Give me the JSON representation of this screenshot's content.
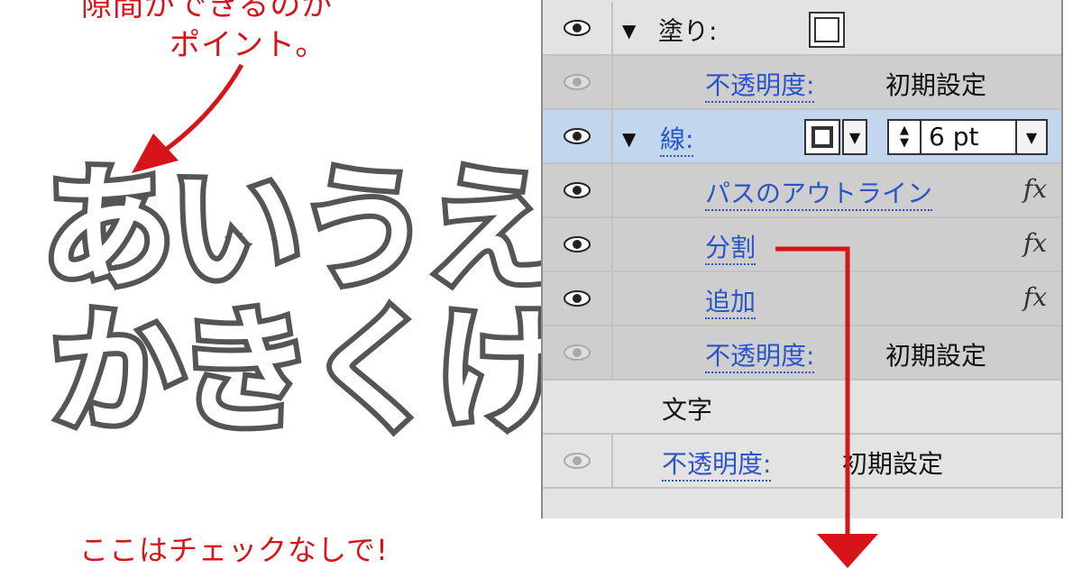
{
  "annotations": {
    "top_line1": "隙間ができるのが",
    "top_line2": "ポイント。",
    "bottom": "ここはチェックなしで!"
  },
  "sample_text": {
    "line1": "あいうえお",
    "line2": "かきくけこ"
  },
  "panel": {
    "fill": {
      "label": "塗り:"
    },
    "opacity_label": "不透明度:",
    "opacity_value": "初期設定",
    "stroke": {
      "label": "線:",
      "weight": "6 pt"
    },
    "effects": [
      {
        "label": "パスのアウトライン",
        "fx": "fx"
      },
      {
        "label": "分割",
        "fx": "fx"
      },
      {
        "label": "追加",
        "fx": "fx"
      }
    ],
    "character_label": "文字"
  },
  "colors": {
    "annotation_red": "#d7141a",
    "link_blue": "#2a55c8",
    "selected_row": "#c2d6ee"
  },
  "icons": [
    "eye-icon",
    "triangle-down-icon",
    "fx-icon",
    "chevron-down-icon",
    "stepper-icon",
    "arrow"
  ]
}
